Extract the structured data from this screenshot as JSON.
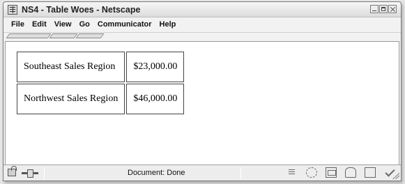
{
  "window": {
    "title": "NS4 - Table Woes - Netscape"
  },
  "menubar": {
    "items": [
      "File",
      "Edit",
      "View",
      "Go",
      "Communicator",
      "Help"
    ]
  },
  "table": {
    "rows": [
      {
        "region": "Southeast Sales Region",
        "amount": "$23,000.00"
      },
      {
        "region": "Northwest Sales Region",
        "amount": "$46,000.00"
      }
    ]
  },
  "statusbar": {
    "text": "Document: Done",
    "icons": [
      "lock-icon",
      "connection-icon",
      "component-bar-icon",
      "navigator-icon",
      "mail-icon",
      "newsgroup-icon",
      "composer-icon",
      "spellcheck-icon"
    ]
  }
}
